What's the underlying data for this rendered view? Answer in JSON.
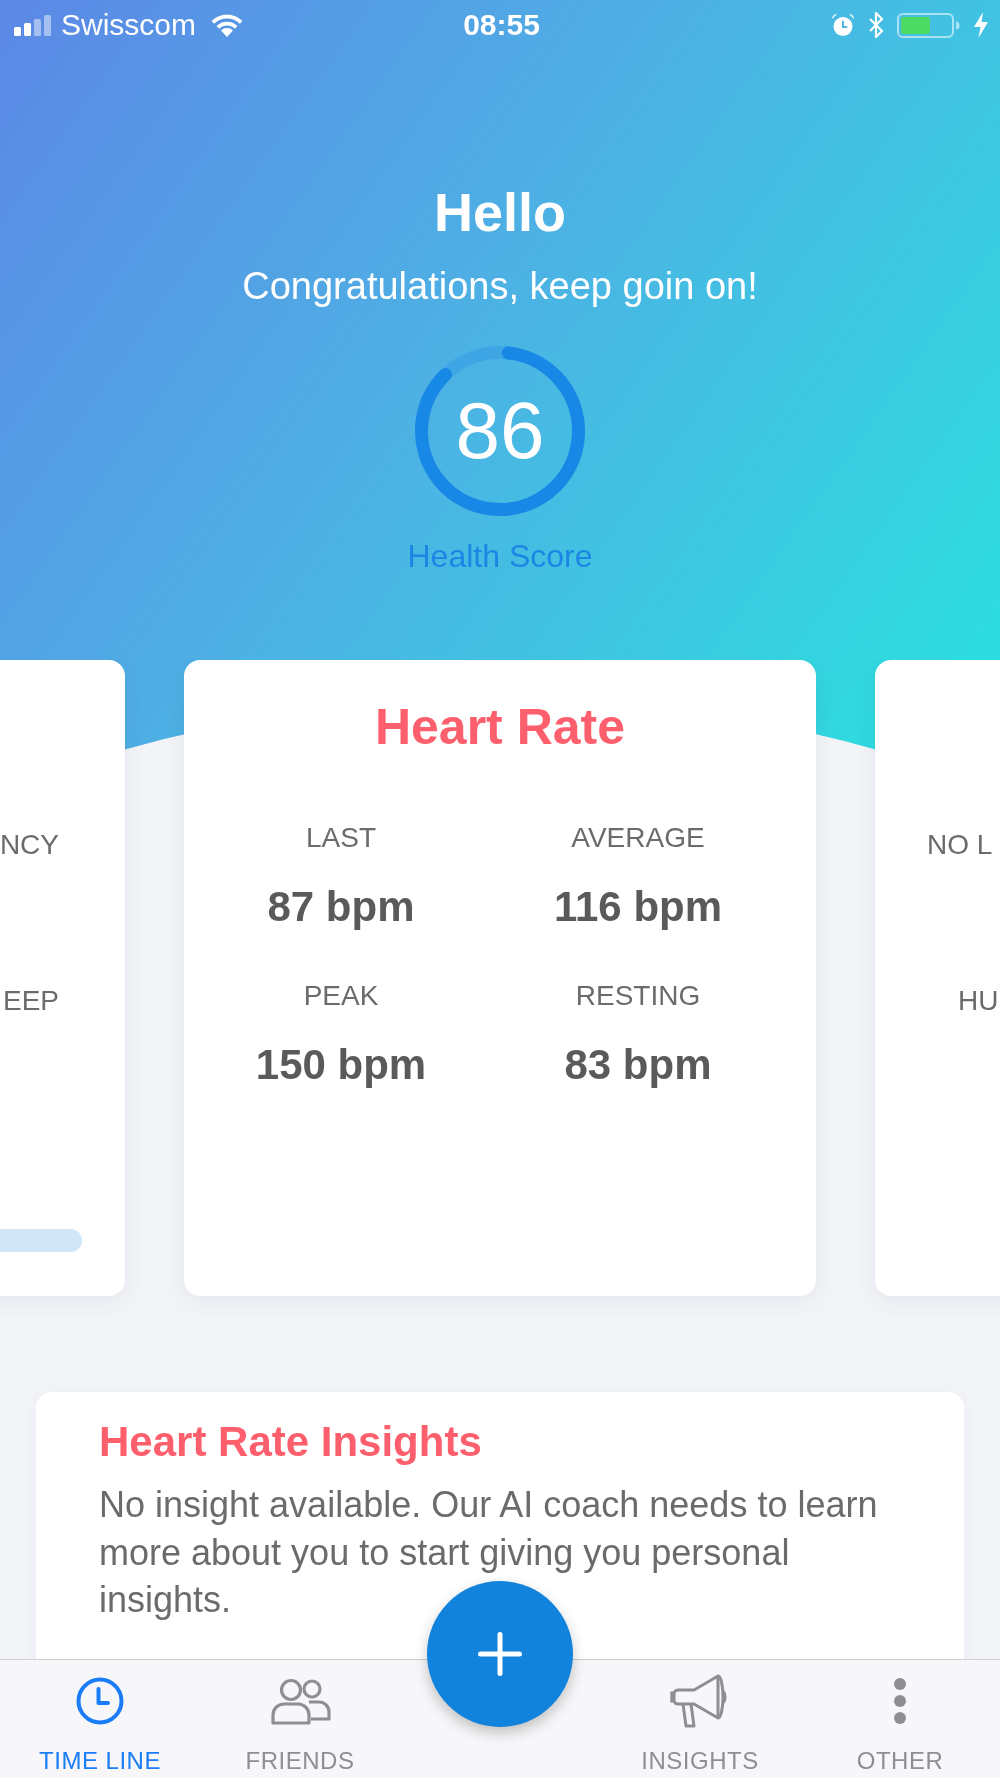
{
  "status_bar": {
    "carrier": "Swisscom",
    "time": "08:55"
  },
  "header": {
    "greeting": "Hello",
    "message": "Congratulations, keep goin on!",
    "score": {
      "value": "86",
      "label": "Health Score",
      "level": 0.86
    }
  },
  "cards": [
    {
      "kind": "cut_left",
      "labels": [
        "NCY",
        "EEP"
      ]
    },
    {
      "kind": "full",
      "title": "Heart Rate",
      "stats": [
        {
          "label": "LAST",
          "value": "87 bpm"
        },
        {
          "label": "AVERAGE",
          "value": "116 bpm"
        },
        {
          "label": "PEAK",
          "value": "150 bpm"
        },
        {
          "label": "RESTING",
          "value": "83 bpm"
        }
      ]
    },
    {
      "kind": "cut_right",
      "labels": [
        "NO L",
        "HU"
      ]
    }
  ],
  "insight": {
    "title": "Heart Rate Insights",
    "text": "No insight available. Our AI coach needs to learn more about you to start giving you personal insights."
  },
  "tab_bar": {
    "tabs": [
      {
        "label": "TIME LINE",
        "selected": true
      },
      {
        "label": "FRIENDS",
        "selected": false
      },
      {
        "label": "INSIGHTS",
        "selected": false
      },
      {
        "label": "OTHER",
        "selected": false
      }
    ]
  }
}
